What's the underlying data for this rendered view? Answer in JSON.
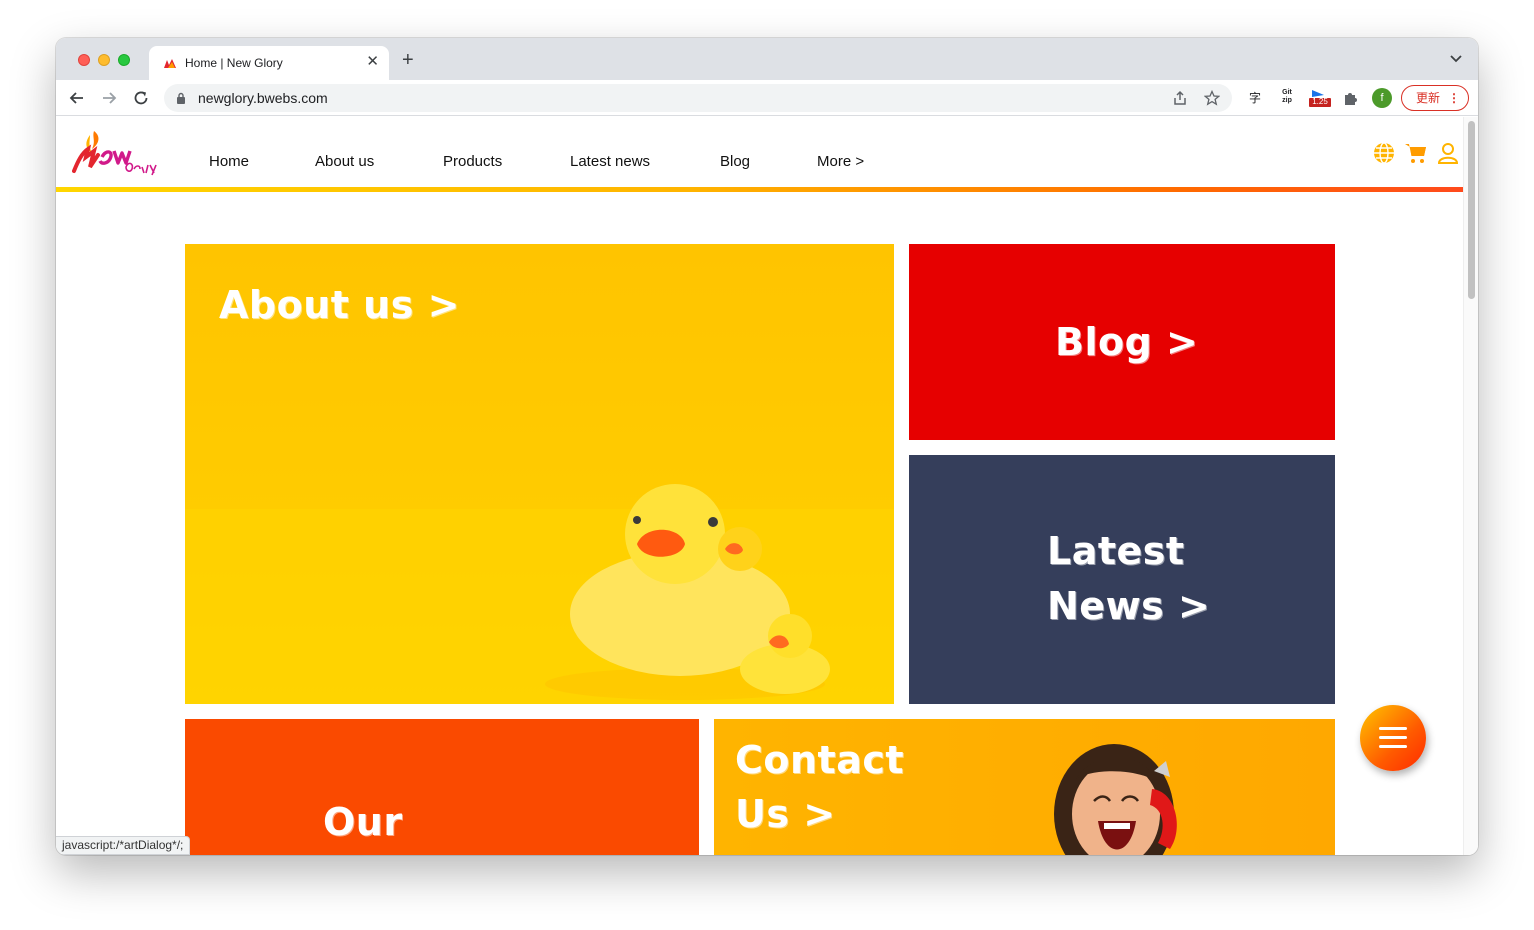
{
  "browser": {
    "tab_title": "Home | New Glory",
    "url": "newglory.bwebs.com",
    "update_label": "更新",
    "update_more": "⋮",
    "profile_initial": "f",
    "ext_translate": "字",
    "ext_gitzip": "Git zip",
    "ext_badge": "1.25",
    "status_text": "javascript:/*artDialog*/;"
  },
  "site": {
    "logo_text": "New Glory",
    "menu": [
      "Home",
      "About us",
      "Products",
      "Latest news",
      "Blog",
      "More >"
    ],
    "brand_colors": {
      "yellow": "#ffc400",
      "red": "#e60000",
      "navy": "#353e5b",
      "orange": "#fa4a00"
    }
  },
  "tiles": {
    "about": "About us >",
    "blog": "Blog >",
    "news_line1": "Latest",
    "news_line2": "News >",
    "products_line1": "Our",
    "contact_line1": "Contact",
    "contact_line2": "Us >"
  },
  "icons": [
    "globe-icon",
    "cart-icon",
    "user-icon",
    "hamburger-icon"
  ]
}
